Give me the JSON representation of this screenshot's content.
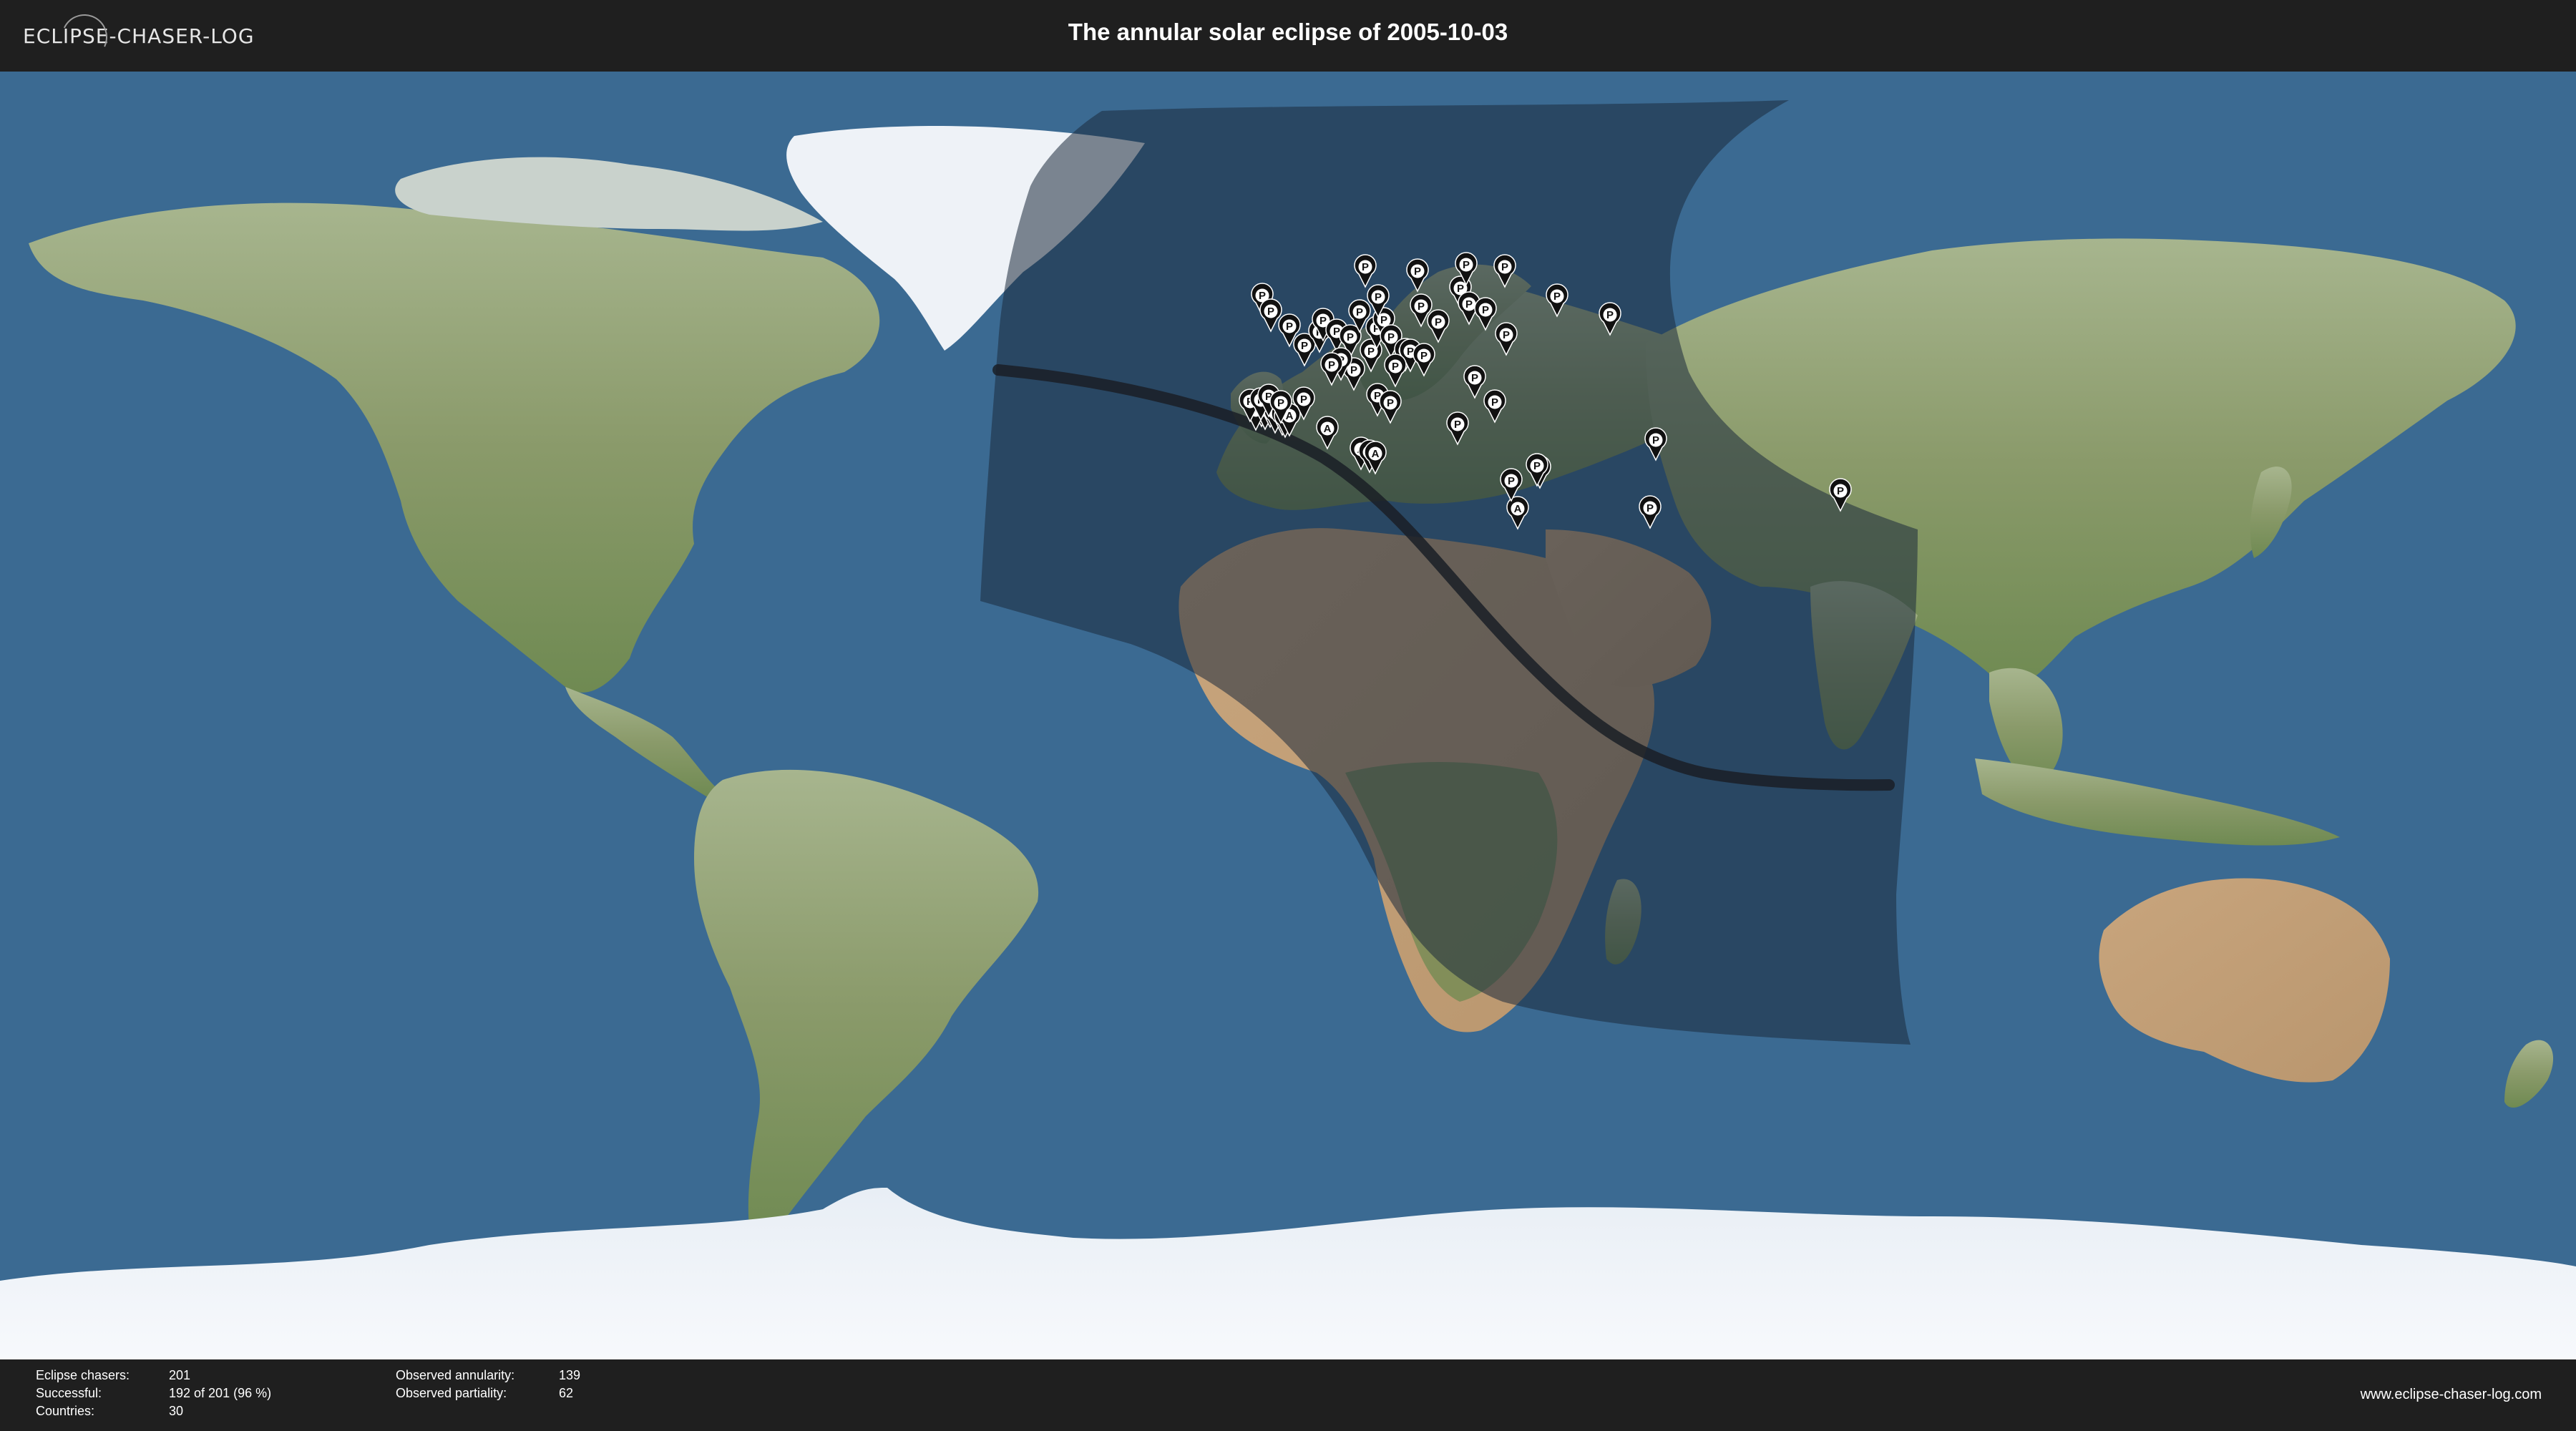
{
  "header": {
    "logo_text": "ECLIPSE-CHASER-LOG",
    "title": "The annular solar eclipse of 2005-10-03"
  },
  "colors": {
    "bar_background": "#1f1f1f",
    "ocean": "#3b6a92",
    "penumbra_shade": "#1b2a3d",
    "central_path": "#1a1f26",
    "pin_fill": "#111111",
    "pin_label_bg": "#ffffff"
  },
  "map": {
    "marker_type_labels": {
      "annular": "A",
      "partial": "P"
    },
    "observer_markers": [
      {
        "lon": -3.7,
        "lat": 40.4,
        "t": "A"
      },
      {
        "lon": -3.2,
        "lat": 40.0,
        "t": "A"
      },
      {
        "lon": -4.5,
        "lat": 39.9,
        "t": "A"
      },
      {
        "lon": -2.5,
        "lat": 40.3,
        "t": "A"
      },
      {
        "lon": -1.8,
        "lat": 39.5,
        "t": "A"
      },
      {
        "lon": -0.8,
        "lat": 39.2,
        "t": "A"
      },
      {
        "lon": -0.4,
        "lat": 38.9,
        "t": "A"
      },
      {
        "lon": 0.2,
        "lat": 39.1,
        "t": "A"
      },
      {
        "lon": -5.3,
        "lat": 41.1,
        "t": "P"
      },
      {
        "lon": -3.8,
        "lat": 41.3,
        "t": "P"
      },
      {
        "lon": -2.7,
        "lat": 41.8,
        "t": "P"
      },
      {
        "lon": -1.0,
        "lat": 40.9,
        "t": "P"
      },
      {
        "lon": 2.2,
        "lat": 41.4,
        "t": "P"
      },
      {
        "lon": 5.5,
        "lat": 37.3,
        "t": "A"
      },
      {
        "lon": 10.2,
        "lat": 34.4,
        "t": "A"
      },
      {
        "lon": 11.4,
        "lat": 34.0,
        "t": "A"
      },
      {
        "lon": 12.2,
        "lat": 33.8,
        "t": "A"
      },
      {
        "lon": 32.1,
        "lat": 26.1,
        "t": "A"
      },
      {
        "lon": -3.6,
        "lat": 55.9,
        "t": "P"
      },
      {
        "lon": -2.4,
        "lat": 53.7,
        "t": "P"
      },
      {
        "lon": 0.2,
        "lat": 51.6,
        "t": "P"
      },
      {
        "lon": 2.3,
        "lat": 48.9,
        "t": "P"
      },
      {
        "lon": 4.4,
        "lat": 50.8,
        "t": "P"
      },
      {
        "lon": 4.9,
        "lat": 52.4,
        "t": "P"
      },
      {
        "lon": 6.8,
        "lat": 50.9,
        "t": "P"
      },
      {
        "lon": 8.7,
        "lat": 50.1,
        "t": "P"
      },
      {
        "lon": 9.2,
        "lat": 45.5,
        "t": "P"
      },
      {
        "lon": 7.4,
        "lat": 46.9,
        "t": "P"
      },
      {
        "lon": 10.0,
        "lat": 53.6,
        "t": "P"
      },
      {
        "lon": 11.6,
        "lat": 48.1,
        "t": "P"
      },
      {
        "lon": 12.4,
        "lat": 51.3,
        "t": "P"
      },
      {
        "lon": 13.4,
        "lat": 52.5,
        "t": "P"
      },
      {
        "lon": 14.4,
        "lat": 50.1,
        "t": "P"
      },
      {
        "lon": 12.5,
        "lat": 41.9,
        "t": "P"
      },
      {
        "lon": 14.3,
        "lat": 40.9,
        "t": "P"
      },
      {
        "lon": 16.4,
        "lat": 48.2,
        "t": "P"
      },
      {
        "lon": 18.6,
        "lat": 54.4,
        "t": "P"
      },
      {
        "lon": 17.1,
        "lat": 48.1,
        "t": "P"
      },
      {
        "lon": 19.0,
        "lat": 47.5,
        "t": "P"
      },
      {
        "lon": 21.0,
        "lat": 52.2,
        "t": "P"
      },
      {
        "lon": 24.1,
        "lat": 56.9,
        "t": "P"
      },
      {
        "lon": 25.3,
        "lat": 54.7,
        "t": "P"
      },
      {
        "lon": 24.9,
        "lat": 60.2,
        "t": "P"
      },
      {
        "lon": 18.1,
        "lat": 59.3,
        "t": "P"
      },
      {
        "lon": 10.8,
        "lat": 59.9,
        "t": "P"
      },
      {
        "lon": 12.6,
        "lat": 55.7,
        "t": "P"
      },
      {
        "lon": 30.3,
        "lat": 59.9,
        "t": "P"
      },
      {
        "lon": 26.1,
        "lat": 44.4,
        "t": "P"
      },
      {
        "lon": 23.7,
        "lat": 37.9,
        "t": "P"
      },
      {
        "lon": 30.5,
        "lat": 50.4,
        "t": "P"
      },
      {
        "lon": 27.6,
        "lat": 53.9,
        "t": "P"
      },
      {
        "lon": 37.6,
        "lat": 55.8,
        "t": "P"
      },
      {
        "lon": 45.0,
        "lat": 53.2,
        "t": "P"
      },
      {
        "lon": 35.2,
        "lat": 31.8,
        "t": "P"
      },
      {
        "lon": 34.8,
        "lat": 32.1,
        "t": "P"
      },
      {
        "lon": 31.2,
        "lat": 30.0,
        "t": "P"
      },
      {
        "lon": 51.4,
        "lat": 35.7,
        "t": "P"
      },
      {
        "lon": 50.6,
        "lat": 26.2,
        "t": "P"
      },
      {
        "lon": 77.2,
        "lat": 28.6,
        "t": "P"
      },
      {
        "lon": 28.9,
        "lat": 41.0,
        "t": "P"
      },
      {
        "lon": 15.0,
        "lat": 46.0,
        "t": "P"
      },
      {
        "lon": 6.1,
        "lat": 46.2,
        "t": "P"
      }
    ]
  },
  "footer": {
    "stats_left": [
      {
        "label": "Eclipse chasers:",
        "value": "201"
      },
      {
        "label": "Successful:",
        "value": "192 of 201 (96 %)"
      },
      {
        "label": "Countries:",
        "value": "30"
      }
    ],
    "stats_right": [
      {
        "label": "Observed annularity:",
        "value": "139"
      },
      {
        "label": "Observed partiality:",
        "value": "62"
      }
    ],
    "website": "www.eclipse-chaser-log.com"
  }
}
